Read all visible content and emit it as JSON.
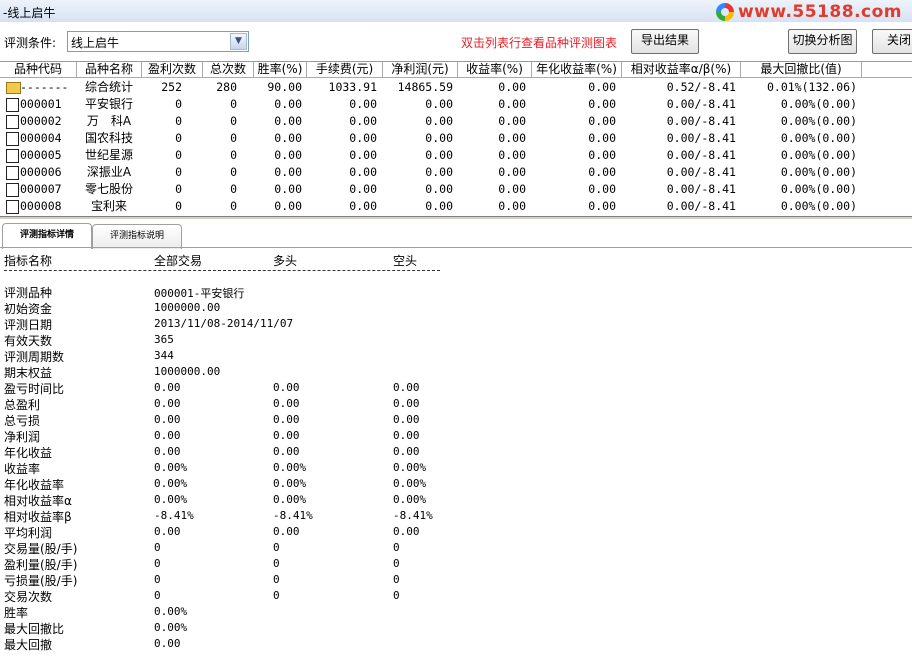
{
  "window": {
    "title": "-线上启牛",
    "watermark": "www.55188.com"
  },
  "toolbar": {
    "condition_label": "评测条件:",
    "condition_value": "线上启牛",
    "hint": "双击列表行查看品种评测图表",
    "export_label": "导出结果",
    "switch_label": "切换分析图",
    "close_label": "关闭"
  },
  "table": {
    "columns": [
      "品种代码",
      "品种名称",
      "盈利次数",
      "总次数",
      "胜率(%)",
      "手续费(元)",
      "净利润(元)",
      "收益率(%)",
      "年化收益率(%)",
      "相对收益率α/β(%)",
      "最大回撤比(值)"
    ],
    "rows": [
      {
        "code": "-------",
        "name": "综合统计",
        "wins": "252",
        "total": "280",
        "winrate": "90.00",
        "fee": "1033.91",
        "profit": "14865.59",
        "ret": "0.00",
        "annual": "0.00",
        "rel": "0.52/-8.41",
        "maxdd": "0.01%(132.06)"
      },
      {
        "code": "000001",
        "name": "平安银行",
        "wins": "0",
        "total": "0",
        "winrate": "0.00",
        "fee": "0.00",
        "profit": "0.00",
        "ret": "0.00",
        "annual": "0.00",
        "rel": "0.00/-8.41",
        "maxdd": "0.00%(0.00)"
      },
      {
        "code": "000002",
        "name": "万　科A",
        "wins": "0",
        "total": "0",
        "winrate": "0.00",
        "fee": "0.00",
        "profit": "0.00",
        "ret": "0.00",
        "annual": "0.00",
        "rel": "0.00/-8.41",
        "maxdd": "0.00%(0.00)"
      },
      {
        "code": "000004",
        "name": "国农科技",
        "wins": "0",
        "total": "0",
        "winrate": "0.00",
        "fee": "0.00",
        "profit": "0.00",
        "ret": "0.00",
        "annual": "0.00",
        "rel": "0.00/-8.41",
        "maxdd": "0.00%(0.00)"
      },
      {
        "code": "000005",
        "name": "世纪星源",
        "wins": "0",
        "total": "0",
        "winrate": "0.00",
        "fee": "0.00",
        "profit": "0.00",
        "ret": "0.00",
        "annual": "0.00",
        "rel": "0.00/-8.41",
        "maxdd": "0.00%(0.00)"
      },
      {
        "code": "000006",
        "name": "深振业A",
        "wins": "0",
        "total": "0",
        "winrate": "0.00",
        "fee": "0.00",
        "profit": "0.00",
        "ret": "0.00",
        "annual": "0.00",
        "rel": "0.00/-8.41",
        "maxdd": "0.00%(0.00)"
      },
      {
        "code": "000007",
        "name": "零七股份",
        "wins": "0",
        "total": "0",
        "winrate": "0.00",
        "fee": "0.00",
        "profit": "0.00",
        "ret": "0.00",
        "annual": "0.00",
        "rel": "0.00/-8.41",
        "maxdd": "0.00%(0.00)"
      },
      {
        "code": "000008",
        "name": "宝利来",
        "wins": "0",
        "total": "0",
        "winrate": "0.00",
        "fee": "0.00",
        "profit": "0.00",
        "ret": "0.00",
        "annual": "0.00",
        "rel": "0.00/-8.41",
        "maxdd": "0.00%(0.00)"
      }
    ]
  },
  "tabs": [
    "评测指标详情",
    "评测指标说明"
  ],
  "detail": {
    "headers": [
      "指标名称",
      "全部交易",
      "多头",
      "空头"
    ],
    "rows": [
      [
        "评测品种",
        "000001-平安银行",
        "",
        ""
      ],
      [
        "初始资金",
        "1000000.00",
        "",
        ""
      ],
      [
        "评测日期",
        "2013/11/08-2014/11/07",
        "",
        ""
      ],
      [
        "有效天数",
        "365",
        "",
        ""
      ],
      [
        "评测周期数",
        "344",
        "",
        ""
      ],
      [
        "期末权益",
        "1000000.00",
        "",
        ""
      ],
      [
        "盈亏时间比",
        "0.00",
        "0.00",
        "0.00"
      ],
      [
        "总盈利",
        "0.00",
        "0.00",
        "0.00"
      ],
      [
        "总亏损",
        "0.00",
        "0.00",
        "0.00"
      ],
      [
        "净利润",
        "0.00",
        "0.00",
        "0.00"
      ],
      [
        "年化收益",
        "0.00",
        "0.00",
        "0.00"
      ],
      [
        "收益率",
        "0.00%",
        "0.00%",
        "0.00%"
      ],
      [
        "年化收益率",
        "0.00%",
        "0.00%",
        "0.00%"
      ],
      [
        "相对收益率α",
        "0.00%",
        "0.00%",
        "0.00%"
      ],
      [
        "相对收益率β",
        "-8.41%",
        "-8.41%",
        "-8.41%"
      ],
      [
        "平均利润",
        "0.00",
        "0.00",
        "0.00"
      ],
      [
        "交易量(股/手)",
        "0",
        "0",
        "0"
      ],
      [
        "盈利量(股/手)",
        "0",
        "0",
        "0"
      ],
      [
        "亏损量(股/手)",
        "0",
        "0",
        "0"
      ],
      [
        "交易次数",
        "0",
        "0",
        "0"
      ],
      [
        "胜率",
        "0.00%",
        "",
        ""
      ],
      [
        "最大回撤比",
        "0.00%",
        "",
        ""
      ],
      [
        "最大回撤",
        "0.00",
        "",
        ""
      ]
    ]
  }
}
